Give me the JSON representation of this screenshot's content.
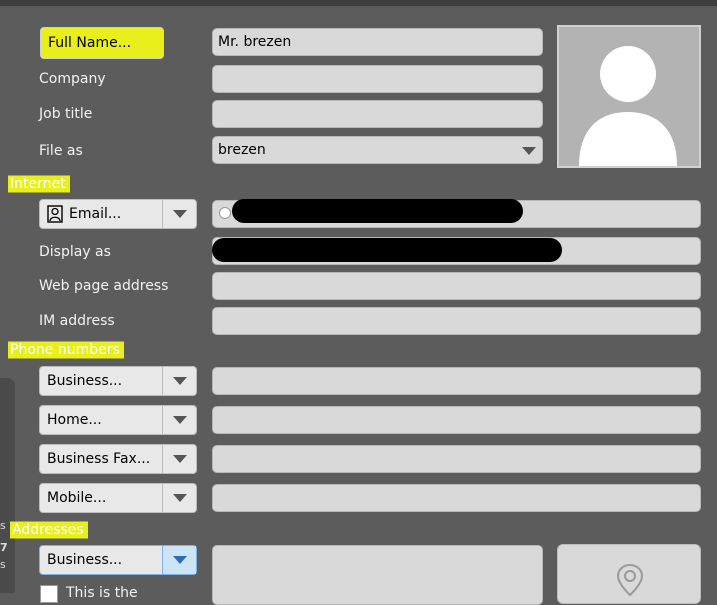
{
  "contact": {
    "full_name_button": "Full Name...",
    "full_name_value": "Mr. brezen",
    "company_label": "Company",
    "company_value": "",
    "job_title_label": "Job title",
    "job_title_value": "",
    "file_as_label": "File as",
    "file_as_value": "brezen"
  },
  "internet": {
    "section_label": "Internet",
    "email_button": "Email...",
    "email_value": "",
    "display_as_label": "Display as",
    "display_as_value": "",
    "web_page_label": "Web page address",
    "web_page_value": "",
    "im_label": "IM address",
    "im_value": ""
  },
  "phones": {
    "section_label": "Phone numbers",
    "items": [
      {
        "label": "Business...",
        "value": ""
      },
      {
        "label": "Home...",
        "value": ""
      },
      {
        "label": "Business Fax...",
        "value": ""
      },
      {
        "label": "Mobile...",
        "value": ""
      }
    ]
  },
  "addresses": {
    "section_label": "Addresses",
    "type_label": "Business...",
    "checkbox_label": "This is the",
    "value": ""
  },
  "sidebar_fragments": [
    "s",
    "7",
    "s"
  ],
  "colors": {
    "background": "#5c5c5c",
    "field": "#d9d9d9",
    "highlight": "#e8ef1a",
    "dropdown_arrow_active": "#cde4f7"
  },
  "icons": {
    "email_contact_icon": "person-card-icon",
    "dropdown": "chevron-down-icon",
    "photo": "contact-avatar-icon",
    "map": "map-pin-icon"
  }
}
